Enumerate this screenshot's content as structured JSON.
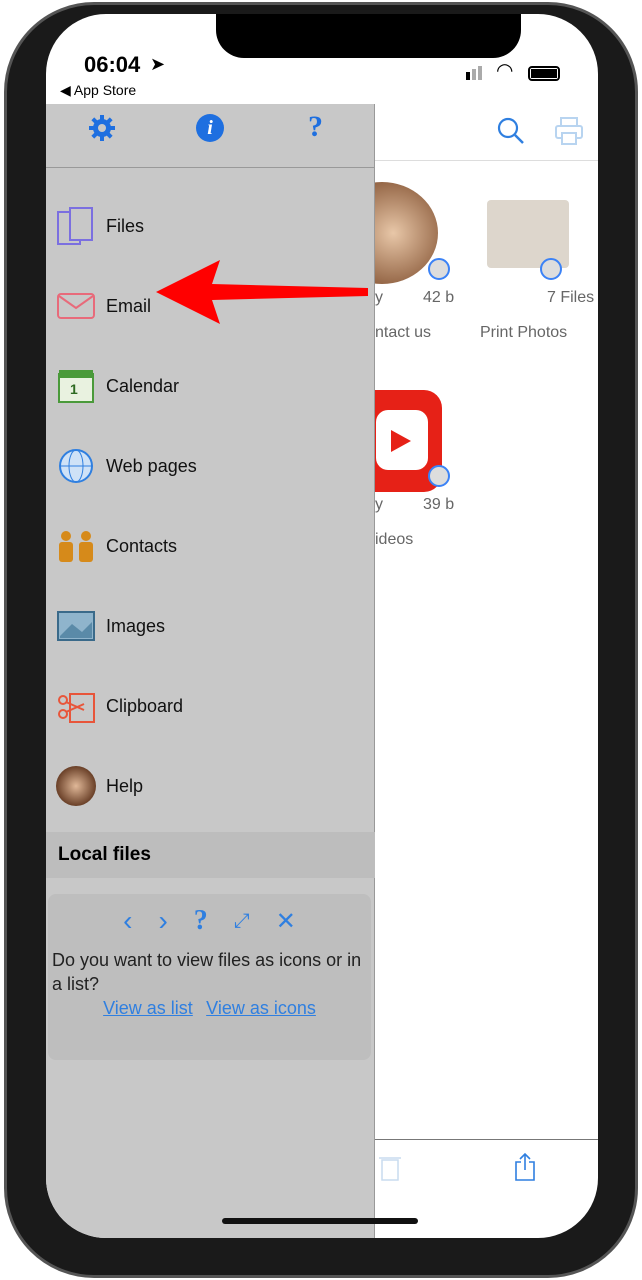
{
  "status": {
    "time": "06:04",
    "back": "App Store"
  },
  "drawer": {
    "top_icons": [
      "gear-icon",
      "info-icon",
      "help-icon"
    ],
    "items": [
      {
        "label": "Files",
        "icon": "files-icon"
      },
      {
        "label": "Email",
        "icon": "email-icon"
      },
      {
        "label": "Calendar",
        "icon": "calendar-icon"
      },
      {
        "label": "Web pages",
        "icon": "globe-icon"
      },
      {
        "label": "Contacts",
        "icon": "contacts-icon"
      },
      {
        "label": "Images",
        "icon": "image-icon"
      },
      {
        "label": "Clipboard",
        "icon": "clipboard-icon"
      },
      {
        "label": "Help",
        "icon": "help-avatar-icon"
      }
    ],
    "section": "Local files",
    "tip": {
      "question": "Do you want to view files as icons or in a list?",
      "view_list": "View as list",
      "view_icons": "View as icons"
    }
  },
  "main": {
    "tiles": [
      {
        "left": "y",
        "size": "42 b",
        "name": "ntact us"
      },
      {
        "size": "7 Files",
        "name": "Print Photos"
      },
      {
        "left": "y",
        "size": "39 b",
        "name": "ideos"
      }
    ]
  },
  "colors": {
    "accent": "#2f7fe0",
    "arrow": "#ff0000",
    "drawer": "#c8c8c8"
  }
}
